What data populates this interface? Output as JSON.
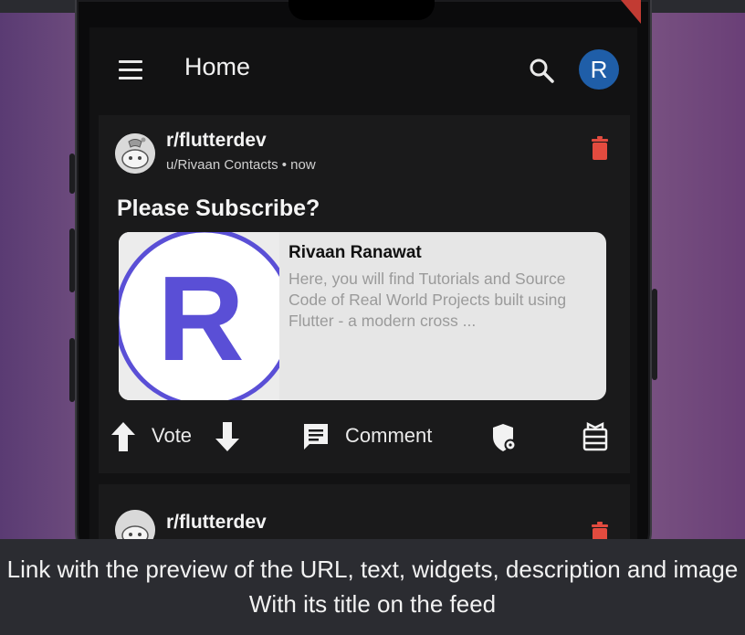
{
  "app": {
    "title": "Home",
    "avatar_letter": "R",
    "accent_color": "#1f5ea8"
  },
  "post": {
    "subreddit": "r/flutterdev",
    "meta": "u/Rivaan Contacts • now",
    "title": "Please Subscribe?",
    "link_preview": {
      "logo_letter": "R",
      "name": "Rivaan Ranawat",
      "description": "Here, you will find Tutorials and Source Code of Real World Projects built using Flutter - a modern cross ..."
    },
    "actions": {
      "vote_label": "Vote",
      "comment_label": "Comment"
    },
    "delete_color": "#e34b3f"
  },
  "next_post": {
    "subreddit": "r/flutterdev"
  },
  "icons": [
    "menu-icon",
    "search-icon",
    "delete-icon",
    "upvote-icon",
    "downvote-icon",
    "comment-icon",
    "mod-shield-icon",
    "award-icon"
  ],
  "caption": "Link with the preview of the URL, text, widgets, description and image With its title on the feed"
}
